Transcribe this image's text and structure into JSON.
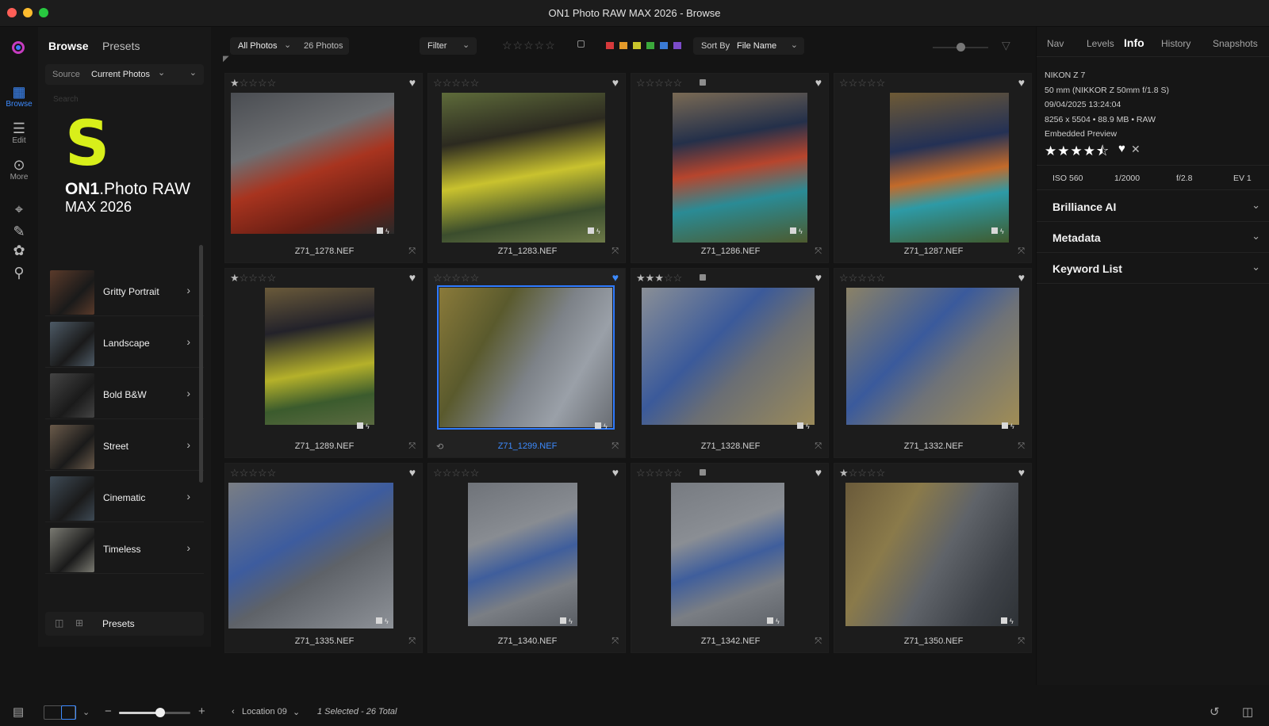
{
  "window": {
    "title": "ON1 Photo RAW MAX 2026 - Browse"
  },
  "rail": {
    "items": [
      {
        "name": "Browse",
        "icon": "browse-grid-icon",
        "active": true
      },
      {
        "name": "Edit",
        "icon": "edit-sliders-icon",
        "active": false
      },
      {
        "name": "More",
        "icon": "more-dots-icon",
        "active": false
      }
    ]
  },
  "left_panel": {
    "tabs": [
      "Browse",
      "Presets"
    ],
    "source_label": "Source",
    "source_value": "Current Photos",
    "search_placeholder": "Search",
    "brand": {
      "mark": "S",
      "name_bold": "ON1",
      "name_rest": ".Photo RAW",
      "version": "MAX 2026"
    },
    "presets": [
      {
        "label": "Gritty Portrait",
        "thumb": "#5a3a2a"
      },
      {
        "label": "Landscape",
        "thumb": "#4d5a66"
      },
      {
        "label": "Bold B&W",
        "thumb": "#444444"
      },
      {
        "label": "Street",
        "thumb": "#6a5a4a"
      },
      {
        "label": "Cinematic",
        "thumb": "#3e4a55"
      },
      {
        "label": "Timeless",
        "thumb": "#7a7a72"
      }
    ],
    "footer_label": "Presets"
  },
  "toolbar": {
    "album": "All Photos",
    "count": "26 Photos",
    "filter": "Filter",
    "sort_label": "Sort By",
    "sort_value": "File Name",
    "color_labels": [
      "#d6393b",
      "#e39a2a",
      "#c9c62c",
      "#3ba83b",
      "#3a7bd5",
      "#7b4bc9"
    ]
  },
  "grid": {
    "photos": [
      {
        "name": "Z71_1278.NEF",
        "rating": 1,
        "flag": false,
        "fav": false,
        "selected": false,
        "tone": "portrait-red"
      },
      {
        "name": "Z71_1283.NEF",
        "rating": 0,
        "flag": false,
        "fav": false,
        "selected": false,
        "tone": "gear-green"
      },
      {
        "name": "Z71_1286.NEF",
        "rating": 0,
        "flag": true,
        "fav": false,
        "selected": false,
        "tone": "gear-navy"
      },
      {
        "name": "Z71_1287.NEF",
        "rating": 0,
        "flag": false,
        "fav": false,
        "selected": false,
        "tone": "gear-forest"
      },
      {
        "name": "Z71_1289.NEF",
        "rating": 1,
        "flag": false,
        "fav": false,
        "selected": false,
        "tone": "gear-dark"
      },
      {
        "name": "Z71_1299.NEF",
        "rating": 0,
        "flag": false,
        "fav": true,
        "selected": true,
        "tone": "climb-top"
      },
      {
        "name": "Z71_1328.NEF",
        "rating": 3,
        "flag": true,
        "fav": false,
        "selected": false,
        "tone": "climb-rock"
      },
      {
        "name": "Z71_1332.NEF",
        "rating": 0,
        "flag": false,
        "fav": false,
        "selected": false,
        "tone": "climb-rock2"
      },
      {
        "name": "Z71_1335.NEF",
        "rating": 0,
        "flag": false,
        "fav": false,
        "selected": false,
        "tone": "climb-close"
      },
      {
        "name": "Z71_1340.NEF",
        "rating": 0,
        "flag": false,
        "fav": false,
        "selected": false,
        "tone": "climb-wall"
      },
      {
        "name": "Z71_1342.NEF",
        "rating": 0,
        "flag": true,
        "fav": false,
        "selected": false,
        "tone": "climb-wall2"
      },
      {
        "name": "Z71_1350.NEF",
        "rating": 1,
        "flag": false,
        "fav": false,
        "selected": false,
        "tone": "climb-wide"
      }
    ]
  },
  "right_panel": {
    "tabs": [
      "Nav",
      "Levels",
      "Info",
      "History",
      "Snapshots"
    ],
    "active_tab": "Info",
    "info": {
      "camera": "NIKON Z 7",
      "lens": "50 mm (NIKKOR Z 50mm f/1.8 S)",
      "datetime": "09/04/2025 13:24:04",
      "dims": "8256 x 5504  •  88.9 MB  •  RAW",
      "preview": "Embedded Preview",
      "rating": 4.5
    },
    "exif": {
      "iso": "ISO 560",
      "shutter": "1/2000",
      "aperture": "f/2.8",
      "ev": "EV 1"
    },
    "sections": [
      "Brilliance AI",
      "Metadata",
      "Keyword List"
    ]
  },
  "bottombar": {
    "location": "Location 09",
    "status": "1 Selected - 26 Total",
    "zoom": 0.58
  }
}
